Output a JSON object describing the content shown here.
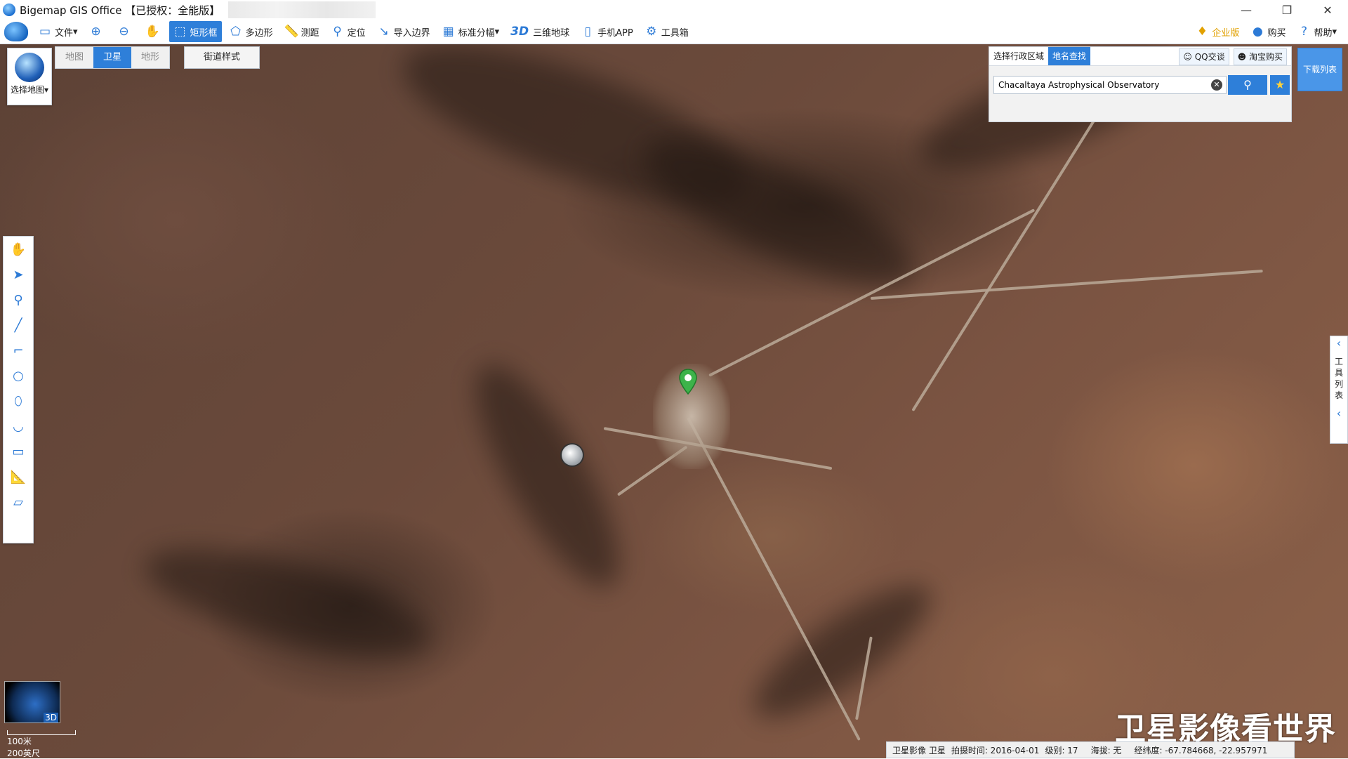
{
  "window": {
    "title": "Bigemap GIS Office 【已授权：全能版】",
    "controls": [
      "—",
      "❐",
      "✕"
    ]
  },
  "toolbar": {
    "file_label": "文件",
    "rect_label": "矩形框",
    "polygon_label": "多边形",
    "measure_label": "测距",
    "locate_label": "定位",
    "import_label": "导入边界",
    "grid_label": "标准分幅",
    "threed_badge": "3D",
    "globe_label": "三维地球",
    "phone_label": "手机APP",
    "toolbox_label": "工具箱",
    "enterprise_label": "企业版",
    "buy_label": "购买",
    "help_label": "帮助"
  },
  "map_selector": {
    "label": "选择地图",
    "types": [
      "地图",
      "卫星",
      "地形"
    ],
    "selected": "卫星",
    "street_style": "街道样式"
  },
  "search": {
    "tabs": [
      "选择行政区域",
      "地名查找"
    ],
    "selected_tab": "地名查找",
    "qq_label": "QQ交谈",
    "taobao_label": "淘宝购买",
    "value": "Chacaltaya Astrophysical Observatory",
    "download_label": "下载列表"
  },
  "tool_list": {
    "label": "工具列表"
  },
  "mini_globe": {
    "badge": "3D"
  },
  "scale": {
    "metric": "100米",
    "imperial": "200英尺"
  },
  "watermark": "卫星影像看世界",
  "status": {
    "source": "卫星影像 卫星",
    "capture_time": "拍摄时间: 2016-04-01",
    "level": "级别:  17",
    "altitude": "海拔: 无",
    "coords": "经纬度:  -67.784668, -22.957971"
  },
  "colors": {
    "accent": "#2e7fd9",
    "pin": "#3db34a"
  }
}
